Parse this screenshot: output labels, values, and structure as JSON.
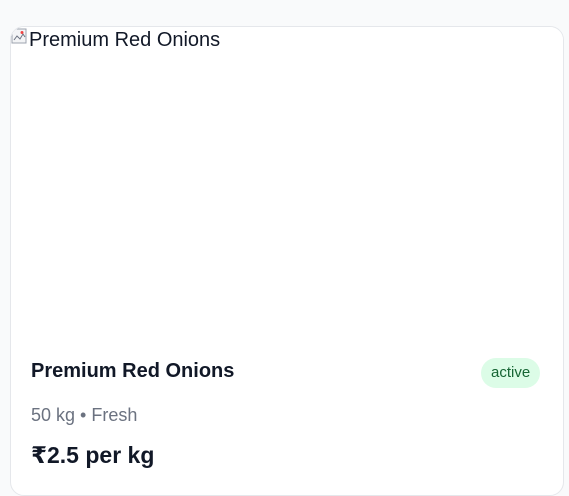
{
  "product": {
    "image_alt": "Premium Red Onions",
    "title": "Premium Red Onions",
    "status": "active",
    "meta": "50 kg • Fresh",
    "price": "₹2.5 per kg"
  },
  "colors": {
    "badge_bg": "#dcfce7",
    "badge_text": "#166534",
    "card_border": "#e5e7eb",
    "page_bg": "#f9fafb"
  },
  "icons": {
    "broken_image": "broken-image-icon"
  }
}
